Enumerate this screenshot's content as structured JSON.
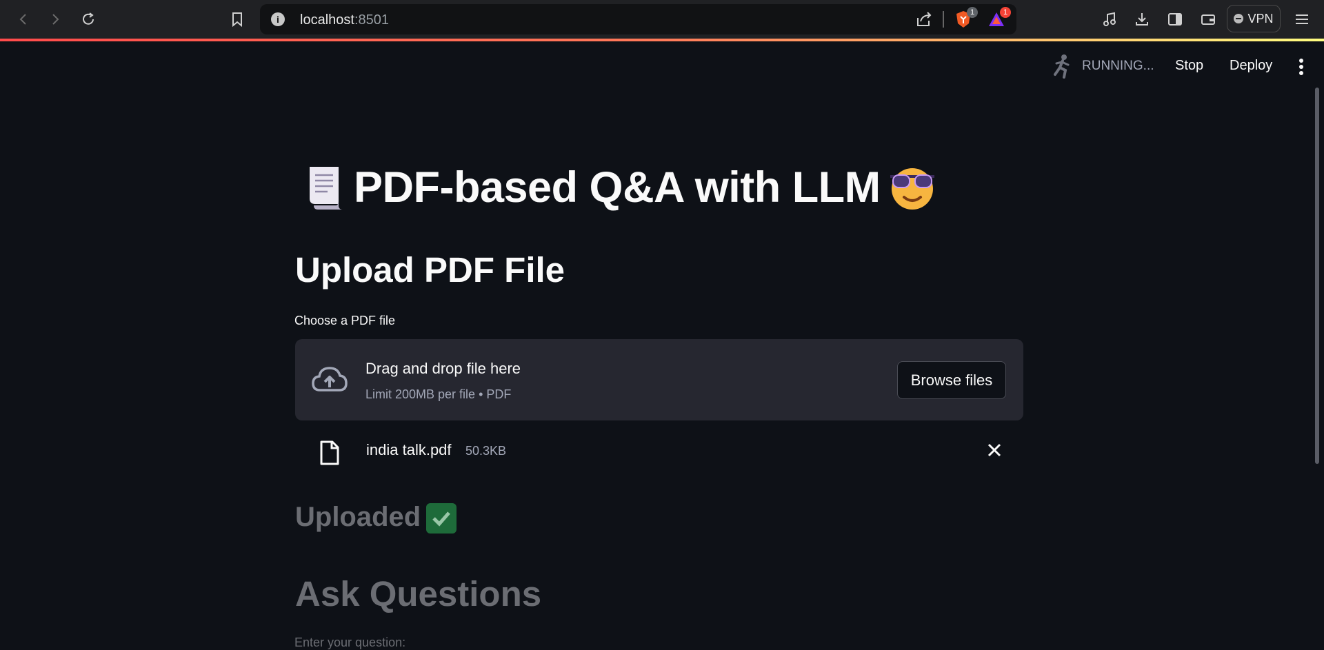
{
  "browser": {
    "url_host": "localhost",
    "url_port": ":8501",
    "brave_badge": "1",
    "rewards_badge": "1",
    "vpn_label": "VPN",
    "colors": {
      "gradient_start": "#ff4b4b",
      "gradient_end": "#fffd80"
    }
  },
  "app_header": {
    "status": "RUNNING...",
    "stop_label": "Stop",
    "deploy_label": "Deploy"
  },
  "main": {
    "title": "PDF-based Q&A with LLM",
    "upload_heading": "Upload PDF File",
    "uploader_label": "Choose a PDF file",
    "dropzone_title": "Drag and drop file here",
    "dropzone_limit": "Limit 200MB per file • PDF",
    "browse_label": "Browse files",
    "file": {
      "name": "india talk.pdf",
      "size": "50.3KB"
    },
    "uploaded_text": "Uploaded",
    "ask_heading": "Ask Questions",
    "question_label": "Enter your question:"
  },
  "icons": [
    "back-icon",
    "forward-icon",
    "reload-icon",
    "bookmark-icon",
    "info-icon",
    "share-icon",
    "brave-shield-icon",
    "brave-rewards-icon",
    "music-icon",
    "download-icon",
    "sidebar-icon",
    "wallet-icon",
    "menu-icon",
    "running-man-icon",
    "more-vert-icon",
    "page-scroll-emoji",
    "sunglasses-emoji",
    "cloud-upload-icon",
    "file-icon",
    "close-icon",
    "check-mark-emoji"
  ]
}
